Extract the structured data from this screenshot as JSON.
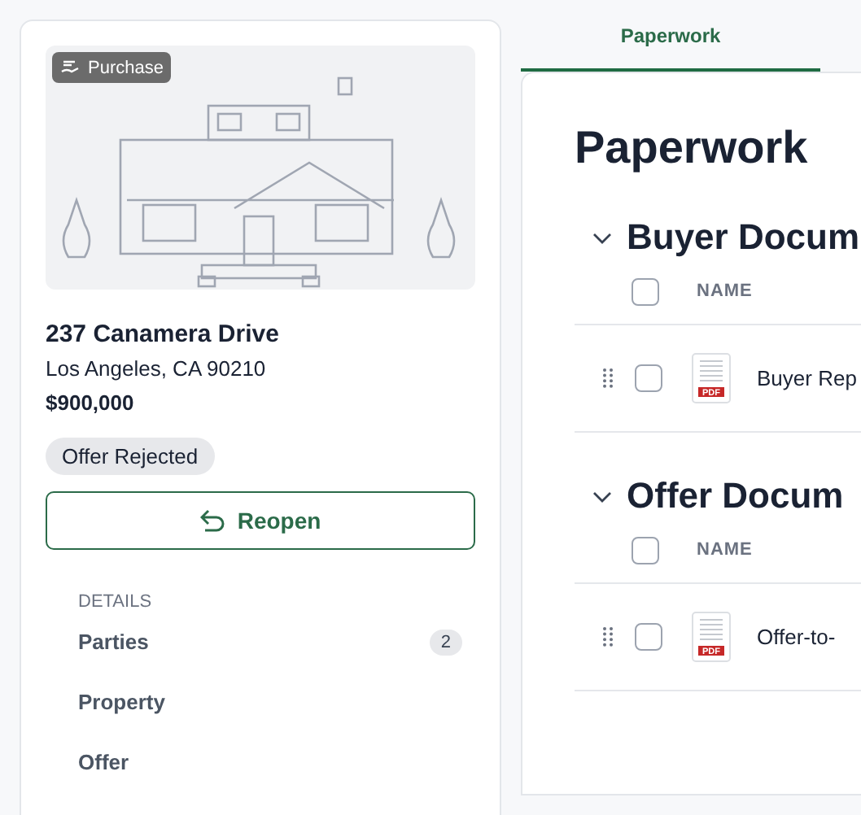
{
  "listing": {
    "tag": "Purchase",
    "address": "237 Canamera Drive",
    "city": "Los Angeles, CA 90210",
    "price": "$900,000",
    "status": "Offer Rejected",
    "action": "Reopen",
    "details_heading": "DETAILS",
    "details": [
      {
        "label": "Parties",
        "count": "2"
      },
      {
        "label": "Property"
      },
      {
        "label": "Offer"
      }
    ]
  },
  "tabs": [
    {
      "label": "Paperwork",
      "selected": true
    }
  ],
  "page_title": "Paperwork",
  "sections": [
    {
      "title": "Buyer Docum",
      "expanded": true,
      "column": "NAME",
      "all_checked": false,
      "rows": [
        {
          "name": "Buyer Rep",
          "file_type": "PDF",
          "checked": false
        }
      ]
    },
    {
      "title": "Offer Docum",
      "expanded": true,
      "column": "NAME",
      "all_checked": false,
      "rows": [
        {
          "name": "Offer-to-",
          "file_type": "PDF",
          "checked": false
        }
      ]
    }
  ]
}
